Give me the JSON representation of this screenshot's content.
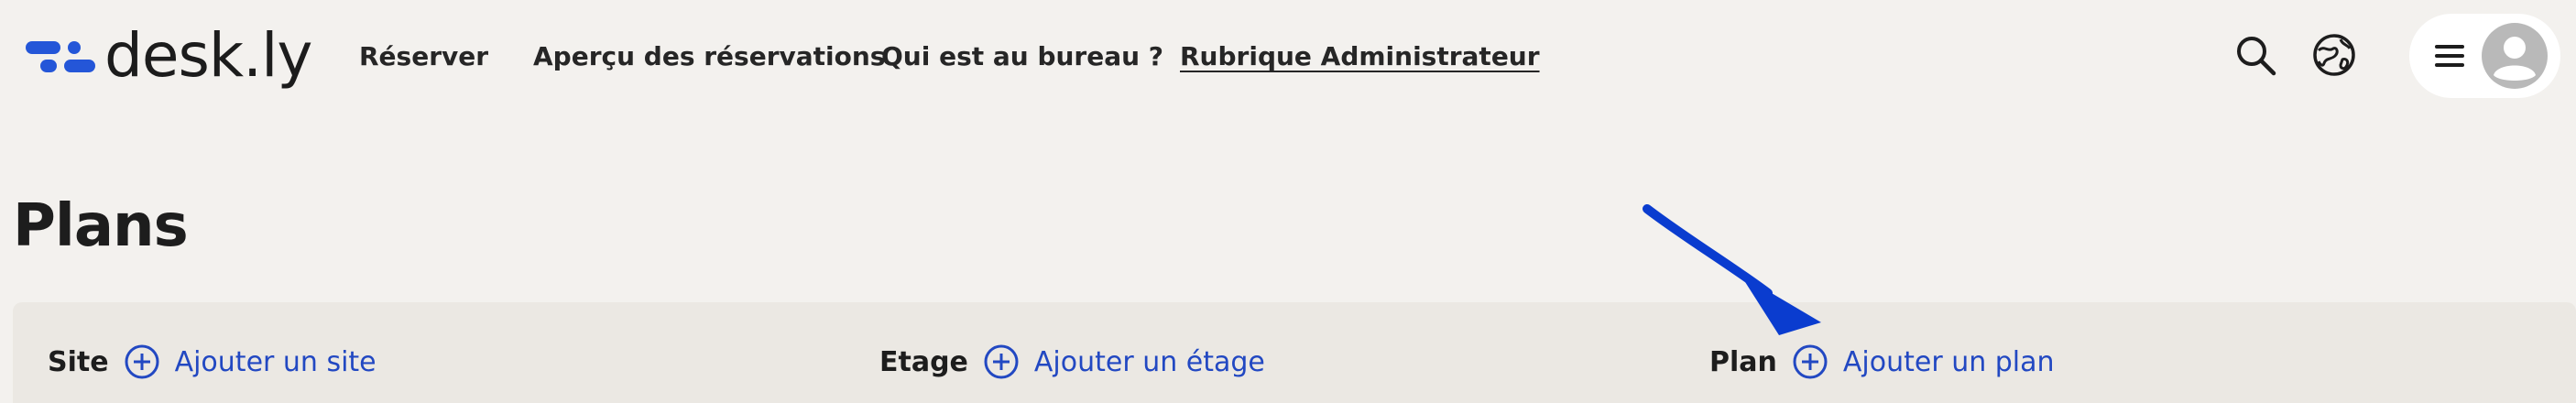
{
  "brand": {
    "name": "desk.ly",
    "color": "#2456d8"
  },
  "nav": {
    "items": [
      {
        "label": "Réserver"
      },
      {
        "label": "Aperçu des réservations"
      },
      {
        "label": "Qui est au bureau ?"
      },
      {
        "label": "Rubrique Administrateur",
        "active": true
      }
    ]
  },
  "header_icons": [
    "search-icon",
    "globe-icon",
    "menu-icon",
    "user-avatar-icon"
  ],
  "page": {
    "title": "Plans"
  },
  "filters": {
    "site": {
      "label": "Site",
      "action": "Ajouter un site"
    },
    "etage": {
      "label": "Etage",
      "action": "Ajouter un étage"
    },
    "plan": {
      "label": "Plan",
      "action": "Ajouter un plan"
    }
  },
  "colors": {
    "accent": "#2248c2",
    "background": "#f3f1ee",
    "panel": "#ebe8e3"
  }
}
